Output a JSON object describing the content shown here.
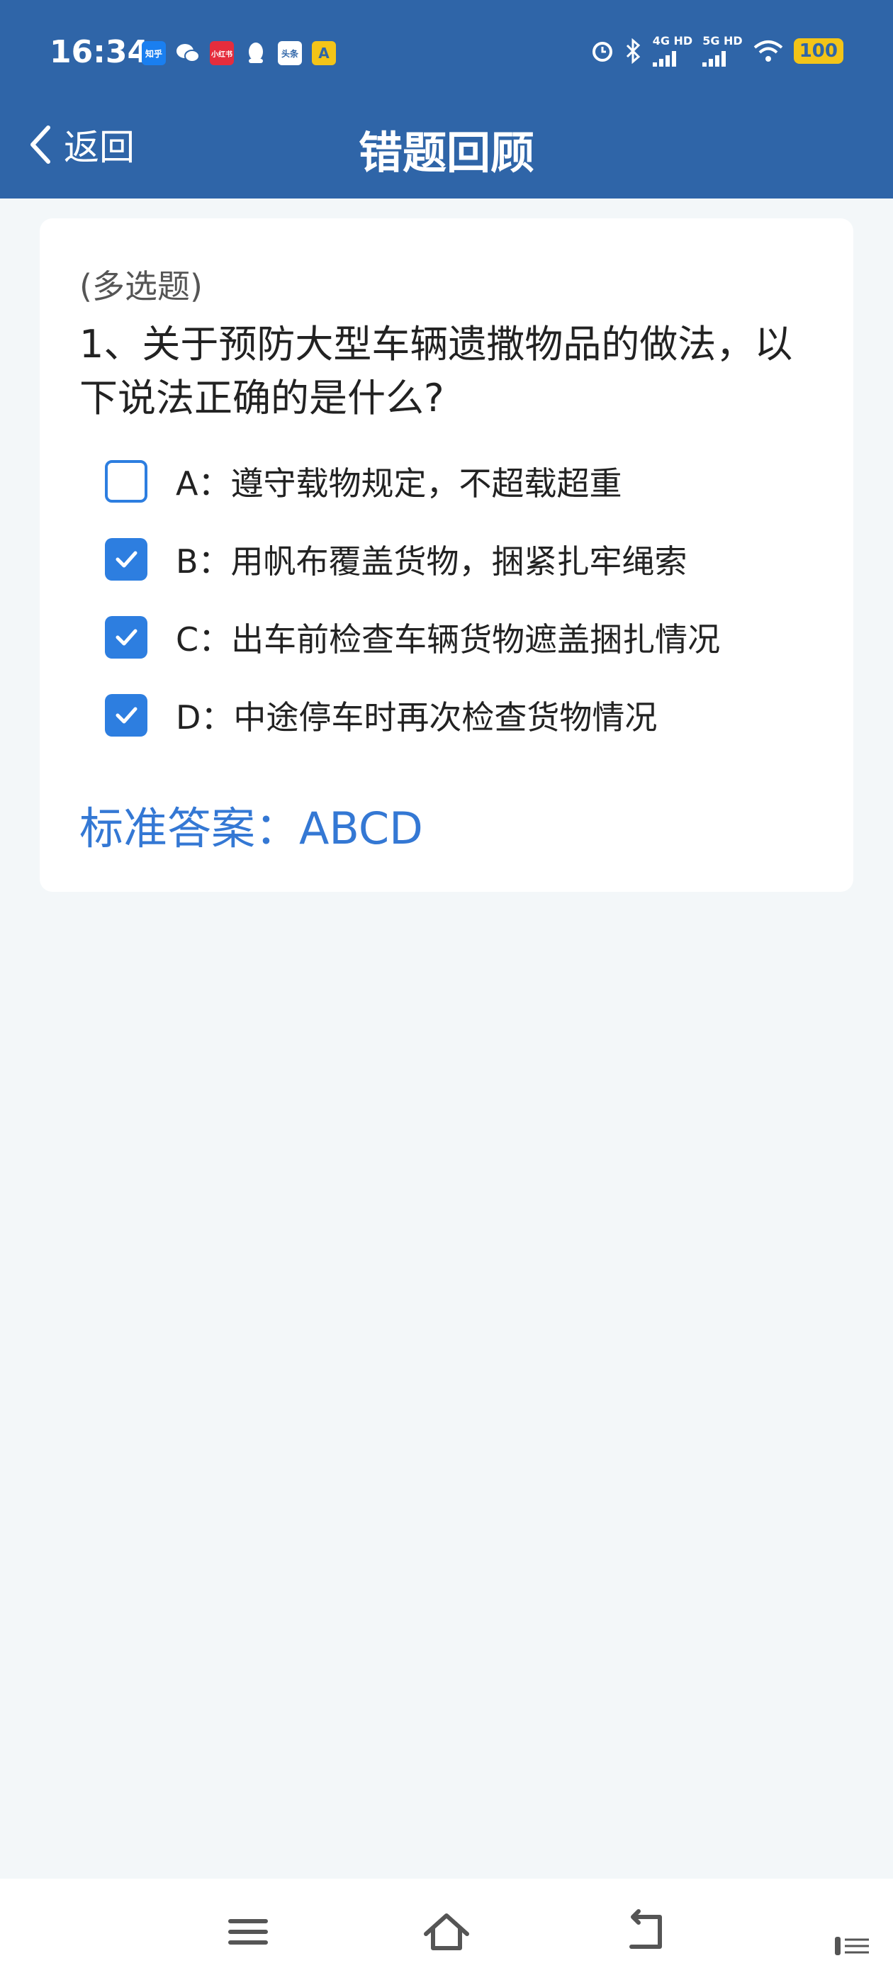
{
  "status_bar": {
    "time": "16:34",
    "apps": [
      "知乎",
      "小红书",
      "头条"
    ],
    "network_4g": "4G HD",
    "network_5g": "5G HD",
    "battery": "100"
  },
  "header": {
    "back_label": "返回",
    "title": "错题回顾"
  },
  "question": {
    "type": "(多选题)",
    "text": "1、关于预防大型车辆遗撒物品的做法，以下说法正确的是什么?",
    "options": [
      {
        "label": "A：遵守载物规定，不超载超重",
        "checked": false
      },
      {
        "label": "B：用帆布覆盖货物，捆紧扎牢绳索",
        "checked": true
      },
      {
        "label": "C：出车前检查车辆货物遮盖捆扎情况",
        "checked": true
      },
      {
        "label": "D：中途停车时再次检查货物情况",
        "checked": true
      }
    ],
    "answer": "标准答案：ABCD"
  },
  "colors": {
    "header": "#2f65a8",
    "accent": "#2d7ee0",
    "answer": "#3478d4",
    "background": "#f3f7f9"
  }
}
